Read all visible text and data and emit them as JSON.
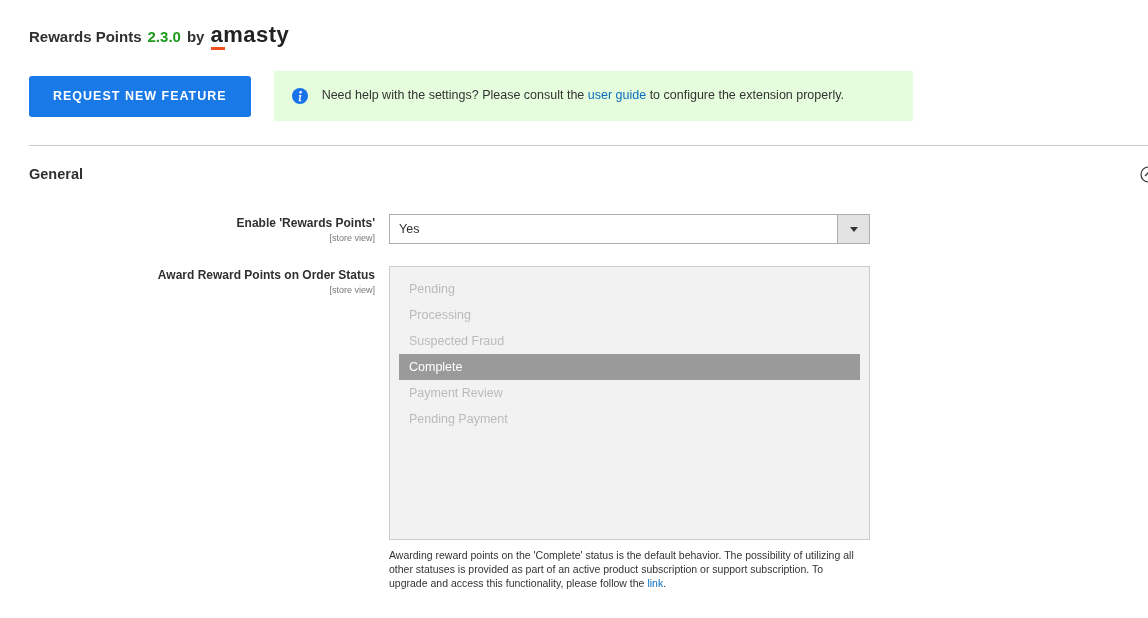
{
  "header": {
    "title": "Rewards Points",
    "version": "2.3.0",
    "by": "by",
    "logo": "amasty"
  },
  "request_button": "REQUEST NEW FEATURE",
  "help_message": {
    "before": "Need help with the settings? Please consult the",
    "link": "user guide",
    "after": "to configure the extension properly."
  },
  "section": {
    "title": "General",
    "expanded": true
  },
  "fields": [
    {
      "kind": "select",
      "label": "Enable 'Rewards Points'",
      "scope": "[store view]",
      "value": "Yes"
    },
    {
      "kind": "multiselect",
      "label": "Award Reward Points on Order Status",
      "scope": "[store view]",
      "disabled": true,
      "options": [
        {
          "label": "Pending",
          "selected": false
        },
        {
          "label": "Processing",
          "selected": false
        },
        {
          "label": "Suspected Fraud",
          "selected": false
        },
        {
          "label": "Complete",
          "selected": true
        },
        {
          "label": "Payment Review",
          "selected": false
        },
        {
          "label": "Pending Payment",
          "selected": false
        }
      ],
      "note": {
        "before": "Awarding reward points on the 'Complete' status is the default behavior. The possibility of utilizing all other statuses is provided as part of an active product subscription or support subscription. To upgrade and access this functionality, please follow the",
        "link": "link",
        "after": "."
      }
    }
  ]
}
